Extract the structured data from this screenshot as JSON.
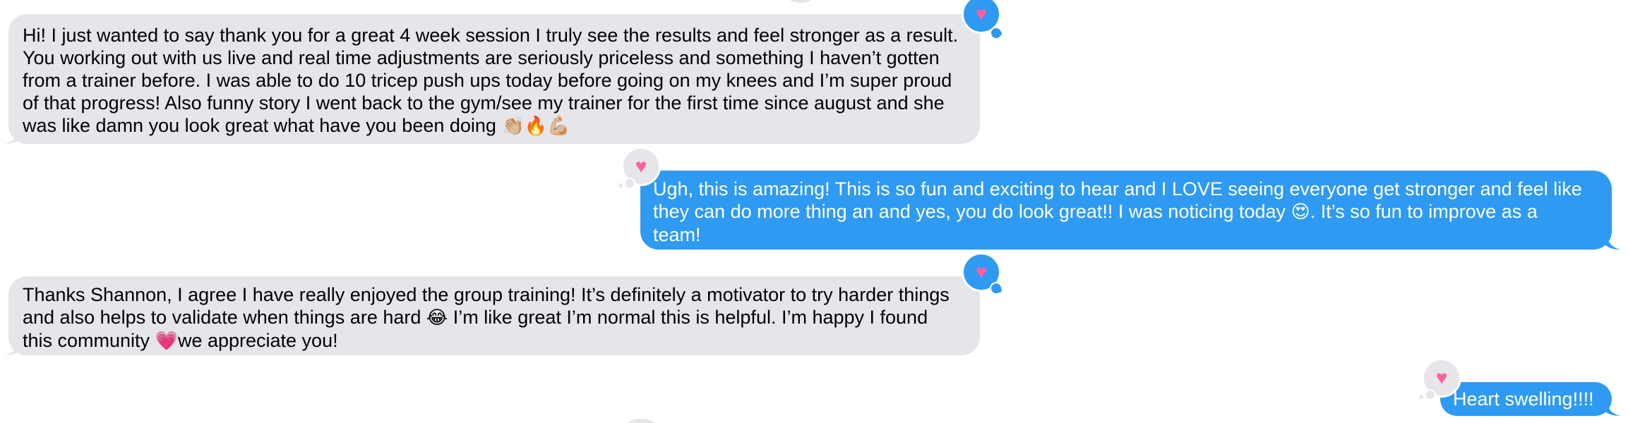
{
  "conversation": {
    "messages": [
      {
        "direction": "received",
        "lines": [
          "Hi! I just wanted to say thank you for a great 4 week session I truly see the results and feel stronger as a result.",
          "You working out with us live and real time adjustments are seriously priceless and something I haven’t gotten",
          "from a trainer before. I was able to do 10 tricep push ups today before going on my knees and I’m super proud",
          "of that progress! Also funny story I went back to the gym/see my trainer for the first time since august and she",
          "was like damn you look great what have you been doing"
        ],
        "trailing_emoji": "👏🏼🔥💪🏼",
        "tapback": "heart"
      },
      {
        "direction": "sent",
        "lines": [
          "Ugh, this is amazing! This is so fun and exciting to hear and I LOVE seeing everyone get stronger and feel like",
          "they can do more thing an and yes, you do look great!! I was noticing today",
          "team!"
        ],
        "inline_emoji": "😍",
        "line2_after_emoji": ". It’s so fun to improve as a",
        "tapback": "heart"
      },
      {
        "direction": "received",
        "lines": [
          "Thanks Shannon, I agree I have really enjoyed the group training! It’s definitely a motivator to try harder things",
          "and also helps to validate when things are hard",
          "this community"
        ],
        "line2_emoji": "😂",
        "line2_after_emoji": " I’m like great I’m normal this is helpful. I’m happy I found",
        "line3_emoji": "💗",
        "line3_after_emoji": "we appreciate you!",
        "tapback": "heart"
      },
      {
        "direction": "sent",
        "lines": [
          "Heart swelling!!!!"
        ],
        "tapback": "heart"
      }
    ]
  },
  "icons": {
    "tapback": "heart-icon",
    "heart_glyph": "♥"
  },
  "colors": {
    "sent_bubble": "#2f9af2",
    "received_bubble": "#e5e5ea",
    "heart": "#ff5fa2"
  }
}
